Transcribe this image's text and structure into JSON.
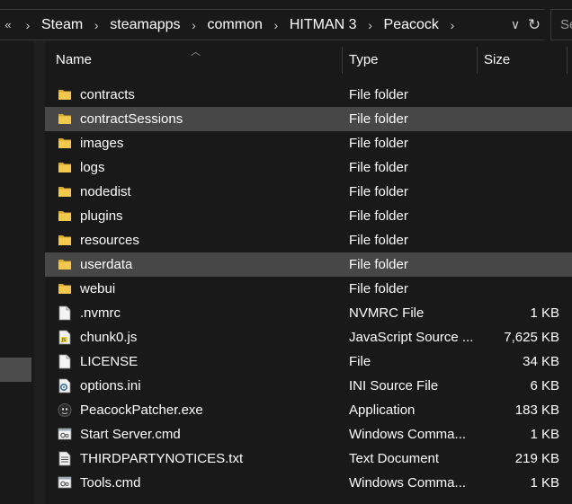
{
  "breadcrumb": {
    "overflow": "«",
    "items": [
      {
        "label": "Steam"
      },
      {
        "label": "steamapps"
      },
      {
        "label": "common"
      },
      {
        "label": "HITMAN 3"
      },
      {
        "label": "Peacock"
      }
    ],
    "separator": "›",
    "dropdown_glyph": "∨",
    "refresh_glyph": "↻"
  },
  "search": {
    "placeholder_visible": "Se"
  },
  "columns": {
    "name": "Name",
    "type": "Type",
    "size": "Size"
  },
  "files": [
    {
      "name": "contracts",
      "type": "File folder",
      "size": "",
      "icon": "folder-icon",
      "state": "normal"
    },
    {
      "name": "contractSessions",
      "type": "File folder",
      "size": "",
      "icon": "folder-icon",
      "state": "selected"
    },
    {
      "name": "images",
      "type": "File folder",
      "size": "",
      "icon": "folder-icon",
      "state": "normal"
    },
    {
      "name": "logs",
      "type": "File folder",
      "size": "",
      "icon": "folder-icon",
      "state": "normal"
    },
    {
      "name": "nodedist",
      "type": "File folder",
      "size": "",
      "icon": "folder-icon",
      "state": "normal"
    },
    {
      "name": "plugins",
      "type": "File folder",
      "size": "",
      "icon": "folder-icon",
      "state": "normal"
    },
    {
      "name": "resources",
      "type": "File folder",
      "size": "",
      "icon": "folder-icon",
      "state": "normal"
    },
    {
      "name": "userdata",
      "type": "File folder",
      "size": "",
      "icon": "folder-icon",
      "state": "selected"
    },
    {
      "name": "webui",
      "type": "File folder",
      "size": "",
      "icon": "folder-icon",
      "state": "normal"
    },
    {
      "name": ".nvmrc",
      "type": "NVMRC File",
      "size": "1 KB",
      "icon": "blank-file-icon",
      "state": "normal"
    },
    {
      "name": "chunk0.js",
      "type": "JavaScript Source ...",
      "size": "7,625 KB",
      "icon": "js-file-icon",
      "state": "normal"
    },
    {
      "name": "LICENSE",
      "type": "File",
      "size": "34 KB",
      "icon": "blank-file-icon",
      "state": "normal"
    },
    {
      "name": "options.ini",
      "type": "INI Source File",
      "size": "6 KB",
      "icon": "ini-file-icon",
      "state": "normal"
    },
    {
      "name": "PeacockPatcher.exe",
      "type": "Application",
      "size": "183 KB",
      "icon": "app-exe-icon",
      "state": "normal"
    },
    {
      "name": "Start Server.cmd",
      "type": "Windows Comma...",
      "size": "1 KB",
      "icon": "cmd-file-icon",
      "state": "normal"
    },
    {
      "name": "THIRDPARTYNOTICES.txt",
      "type": "Text Document",
      "size": "219 KB",
      "icon": "text-file-icon",
      "state": "normal"
    },
    {
      "name": "Tools.cmd",
      "type": "Windows Comma...",
      "size": "1 KB",
      "icon": "cmd-file-icon",
      "state": "normal"
    }
  ],
  "colors": {
    "background": "#191919",
    "selected_row": "#474747",
    "folder": "#f2c94c",
    "text": "#ffffff"
  }
}
